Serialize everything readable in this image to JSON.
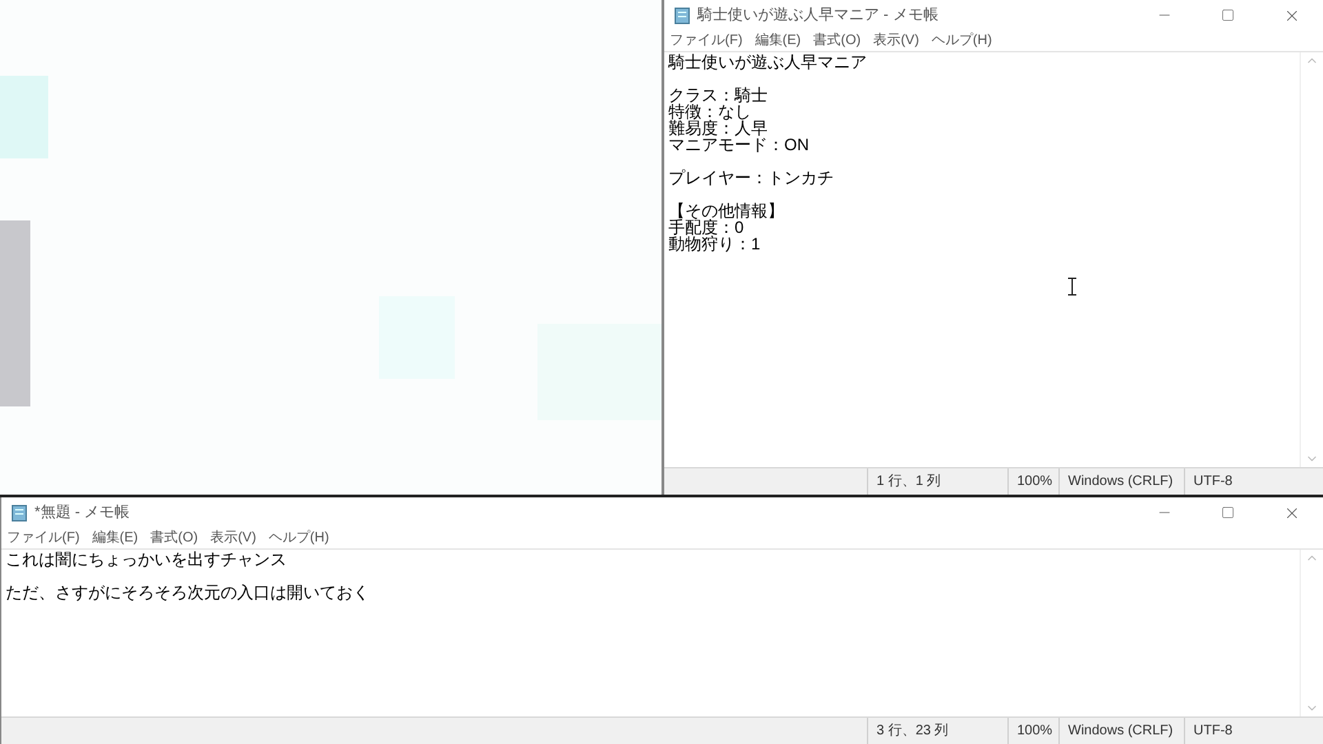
{
  "notepads": [
    {
      "title": "騎士使いが遊ぶ人早マニア - メモ帳",
      "menu": [
        "ファイル(F)",
        "編集(E)",
        "書式(O)",
        "表示(V)",
        "ヘルプ(H)"
      ],
      "paragraphs": [
        [
          "騎士使いが遊ぶ人早マニア"
        ],
        [
          "クラス：騎士",
          "特徴：なし",
          "難易度：人早",
          "マニアモード：ON"
        ],
        [
          "プレイヤー：トンカチ"
        ],
        [
          "【その他情報】",
          "手配度：0",
          "動物狩り：1"
        ]
      ],
      "status": [
        "1 行、1 列",
        "100%",
        "Windows (CRLF)",
        "UTF-8"
      ]
    },
    {
      "title": "*無題 - メモ帳",
      "menu": [
        "ファイル(F)",
        "編集(E)",
        "書式(O)",
        "表示(V)",
        "ヘルプ(H)"
      ],
      "paragraphs": [
        [
          "これは闇にちょっかいを出すチャンス"
        ],
        [
          "ただ、さすがにそろそろ次元の入口は開いておく"
        ]
      ],
      "status": [
        "3 行、23 列",
        "100%",
        "Windows (CRLF)",
        "UTF-8"
      ]
    }
  ]
}
